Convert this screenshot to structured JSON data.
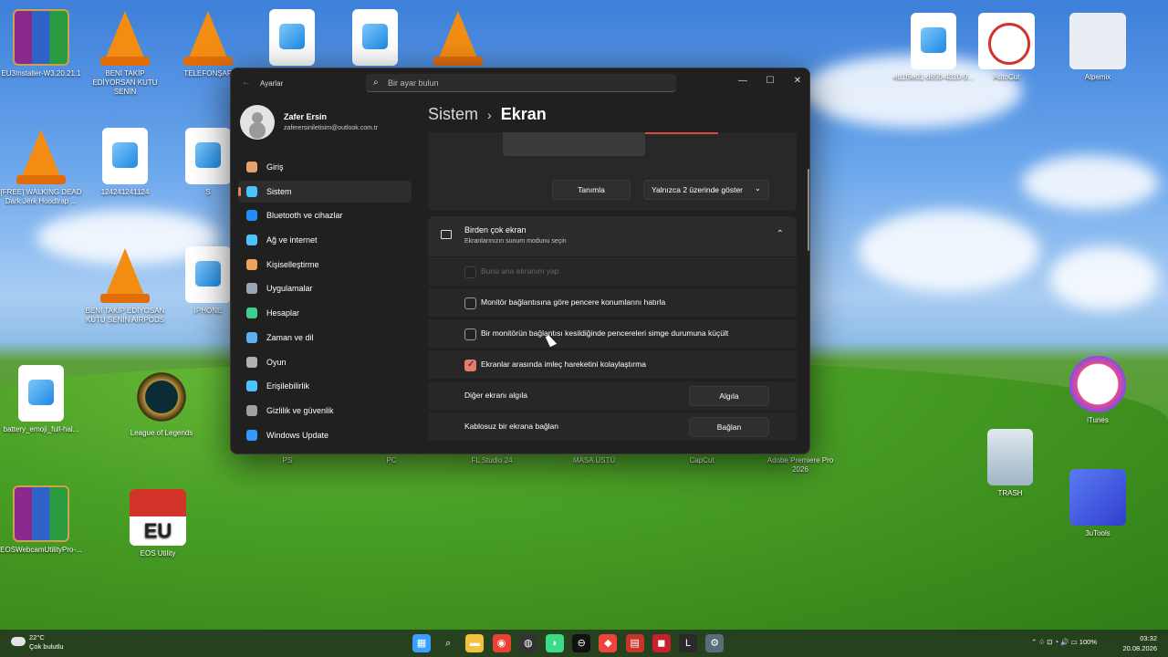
{
  "desktop": {
    "icons": [
      {
        "label": "EU3Installer-W3.20.21.1",
        "type": "rar"
      },
      {
        "label": "BENİ TAKİP EDİYORSAN KUTU SENİN",
        "type": "vlc"
      },
      {
        "label": "TELEFONŞAR",
        "type": "vlc"
      },
      {
        "label": "",
        "type": "img"
      },
      {
        "label": "",
        "type": "img"
      },
      {
        "label": "",
        "type": "vlc"
      },
      {
        "label": "[FREE] WALKING DEAD Dark Jerk Hoodtrap ...",
        "type": "vlc"
      },
      {
        "label": "124241241124",
        "type": "img"
      },
      {
        "label": "S",
        "type": "img"
      },
      {
        "label": "BENİ TAKİP EDİYOSAN KUTU SENİN AIRPODS",
        "type": "vlc"
      },
      {
        "label": "IPHONE",
        "type": "img"
      },
      {
        "label": "battery_emoji_full-hal...",
        "type": "img"
      },
      {
        "label": "League of Legends",
        "type": "lol"
      },
      {
        "label": "EOSWebcamUtilityPro-...",
        "type": "rar"
      },
      {
        "label": "EOS Utility",
        "type": "eu"
      },
      {
        "label": "eb1f9ed1-d650-4310-9...",
        "type": "img"
      },
      {
        "label": "AutoCut",
        "type": "auto"
      },
      {
        "label": "Alpemix",
        "type": "alp"
      },
      {
        "label": "iTunes",
        "type": "itunes"
      },
      {
        "label": "TRASH",
        "type": "trash"
      },
      {
        "label": "3uTools",
        "type": "3u"
      },
      {
        "label": "PS",
        "type": "hidden"
      },
      {
        "label": "PC",
        "type": "hidden"
      },
      {
        "label": "FL Studio 24",
        "type": "hidden"
      },
      {
        "label": "MASA ÜSTÜ",
        "type": "hidden"
      },
      {
        "label": "CapCut",
        "type": "hidden"
      },
      {
        "label": "Adobe Premiere Pro 2026",
        "type": "hidden"
      }
    ],
    "eu_text": "EU"
  },
  "window": {
    "app_title": "Ayarlar",
    "back_glyph": "←",
    "search_placeholder": "Bir ayar bulun",
    "controls": {
      "minimize": "—",
      "maximize": "☐",
      "close": "✕"
    }
  },
  "profile": {
    "name": "Zafer Ersin",
    "email": "zaferersiniletisim@outlook.com.tr"
  },
  "nav": [
    {
      "label": "Giriş",
      "icon": "home-icon",
      "color": "#e8a36d"
    },
    {
      "label": "Sistem",
      "icon": "monitor-icon",
      "color": "#4cc2ff",
      "active": true
    },
    {
      "label": "Bluetooth ve cihazlar",
      "icon": "bluetooth-icon",
      "color": "#1f8fff"
    },
    {
      "label": "Ağ ve internet",
      "icon": "wifi-icon",
      "color": "#4cc2ff"
    },
    {
      "label": "Kişiselleştirme",
      "icon": "brush-icon",
      "color": "#f0a35a"
    },
    {
      "label": "Uygulamalar",
      "icon": "apps-icon",
      "color": "#9aa7b5"
    },
    {
      "label": "Hesaplar",
      "icon": "person-icon",
      "color": "#3ccf8e"
    },
    {
      "label": "Zaman ve dil",
      "icon": "globe-clock-icon",
      "color": "#5ab0f0"
    },
    {
      "label": "Oyun",
      "icon": "gamepad-icon",
      "color": "#b0b0b0"
    },
    {
      "label": "Erişilebilirlik",
      "icon": "accessibility-icon",
      "color": "#4cc2ff"
    },
    {
      "label": "Gizlilik ve güvenlik",
      "icon": "shield-icon",
      "color": "#a0a0a0"
    },
    {
      "label": "Windows Update",
      "icon": "update-icon",
      "color": "#2f9bff"
    }
  ],
  "heading": {
    "crumb": "Sistem",
    "separator": "›",
    "page": "Ekran"
  },
  "preview": {
    "identify_label": "Tanımla",
    "show_only_label": "Yalnızca 2 üzerinde göster",
    "dropdown_glyph": "⌄"
  },
  "multi_display": {
    "title": "Birden çok ekran",
    "subtitle": "Ekranlarınızın sunum modunu seçin",
    "chevron": "⌃",
    "options": [
      {
        "label": "Bunu ana ekranım yap",
        "checked": false,
        "disabled": true
      },
      {
        "label": "Monitör bağlantısına göre pencere konumlarını hatırla",
        "checked": false,
        "disabled": false
      },
      {
        "label": "Bir monitörün bağlantısı kesildiğinde pencereleri simge durumuna küçült",
        "checked": false,
        "disabled": false
      },
      {
        "label": "Ekranlar arasında imleç hareketini kolaylaştırma",
        "checked": true,
        "disabled": false
      }
    ],
    "detect_label": "Diğer ekranı algıla",
    "detect_button": "Algıla",
    "wireless_label": "Kablosuz bir ekrana bağlan",
    "wireless_button": "Bağlan"
  },
  "taskbar": {
    "weather_temp": "22°C",
    "weather_desc": "Çok bulutlu",
    "apps": [
      {
        "name": "start-icon",
        "glyph": "▦",
        "color": "#3aa0ff"
      },
      {
        "name": "search-icon",
        "glyph": "⌕",
        "color": "transparent"
      },
      {
        "name": "file-explorer-icon",
        "glyph": "▬",
        "color": "#f2c23a"
      },
      {
        "name": "chrome-icon",
        "glyph": "◉",
        "color": "#e94235"
      },
      {
        "name": "obs-icon",
        "glyph": "◍",
        "color": "#333333"
      },
      {
        "name": "android-icon",
        "glyph": "◗",
        "color": "#3ddc84"
      },
      {
        "name": "capcut-icon",
        "glyph": "⊖",
        "color": "#111111"
      },
      {
        "name": "anydesk-icon",
        "glyph": "◆",
        "color": "#ef443b"
      },
      {
        "name": "calendar-icon",
        "glyph": "▤",
        "color": "#c8342a"
      },
      {
        "name": "app-red-icon",
        "glyph": "◼",
        "color": "#c8202e"
      },
      {
        "name": "lol-icon",
        "glyph": "L",
        "color": "#2a2a2a"
      },
      {
        "name": "settings-icon",
        "glyph": "⚙",
        "color": "#5a6b7a"
      }
    ],
    "tray_text": "⌃  ♧  ⊡  ◔  🔊  ▭ 100%",
    "time": "03:32",
    "date": "20.08.2026"
  }
}
